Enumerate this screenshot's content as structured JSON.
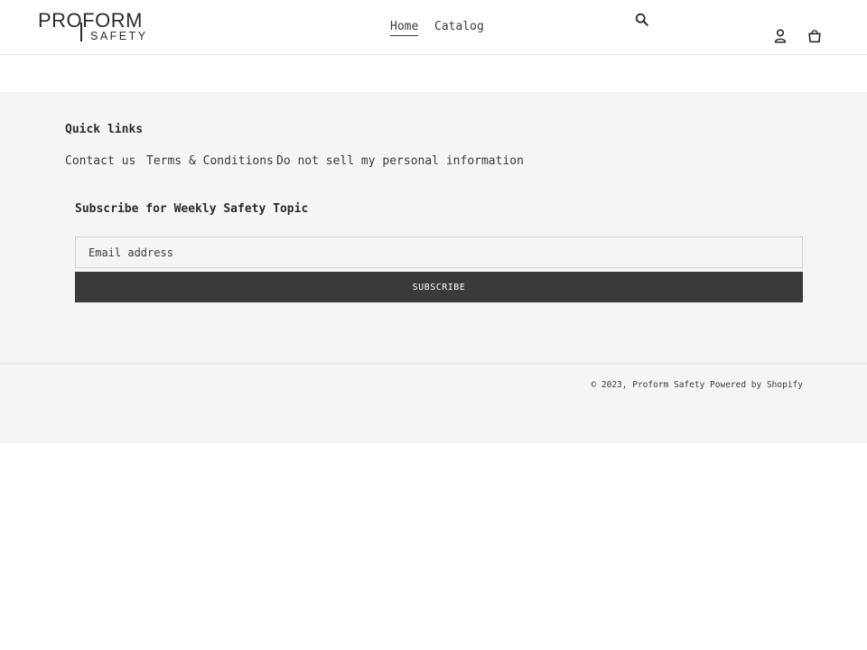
{
  "header": {
    "logo_top": "PROFORM",
    "logo_bottom": "SAFETY",
    "nav": [
      {
        "label": "Home",
        "active": true
      },
      {
        "label": "Catalog",
        "active": false
      }
    ],
    "icons": [
      "search-icon",
      "account-icon",
      "cart-icon"
    ]
  },
  "footer": {
    "quick_links_title": "Quick links",
    "quick_links": [
      "Contact us",
      "Terms & Conditions",
      "Do not sell my personal information"
    ],
    "subscribe_title": "Subscribe for Weekly Safety Topic",
    "email_placeholder": "Email address",
    "subscribe_label": "SUBSCRIBE",
    "copyright": "© 2023,",
    "store_name": "Proform Safety",
    "powered_by": "Powered by Shopify"
  },
  "colors": {
    "footer_bg": "#f5f5f5",
    "button_bg": "#3a3a3a",
    "text": "#3a3a3a"
  }
}
